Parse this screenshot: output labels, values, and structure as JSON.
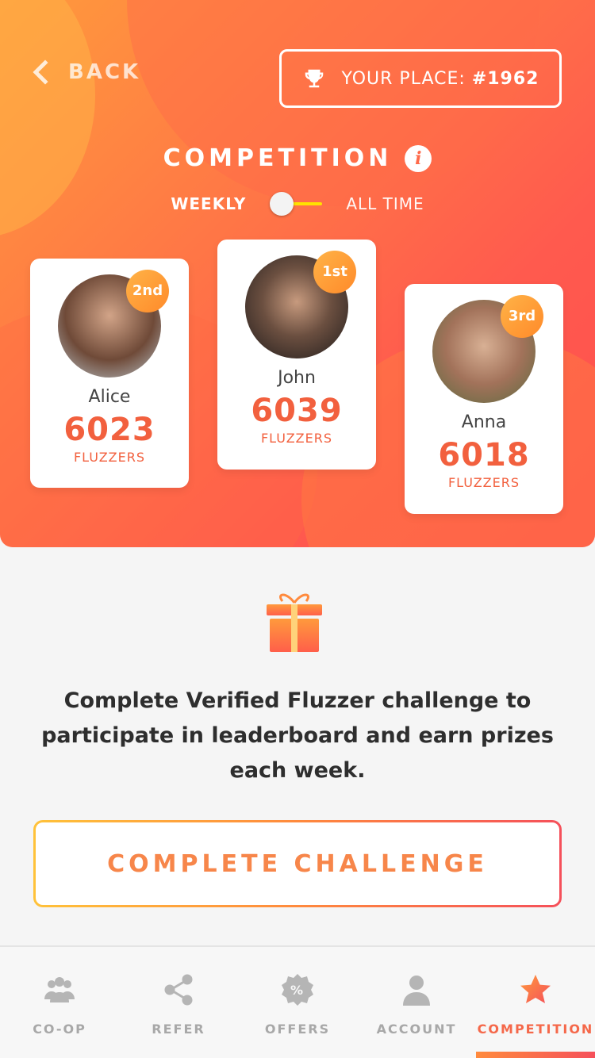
{
  "header": {
    "back_label": "BACK",
    "your_place_label": "YOUR PLACE:",
    "your_place_value": "#1962",
    "title": "COMPETITION",
    "info_icon": "i"
  },
  "period_toggle": {
    "left_label": "WEEKLY",
    "right_label": "ALL TIME",
    "selected": "WEEKLY"
  },
  "leaderboard": [
    {
      "rank": "2nd",
      "name": "Alice",
      "score": "6023",
      "unit": "FLUZZERS"
    },
    {
      "rank": "1st",
      "name": "John",
      "score": "6039",
      "unit": "FLUZZERS"
    },
    {
      "rank": "3rd",
      "name": "Anna",
      "score": "6018",
      "unit": "FLUZZERS"
    }
  ],
  "message": "Complete Verified Fluzzer challenge to participate in leaderboard and earn prizes each week.",
  "cta_label": "COMPLETE CHALLENGE",
  "nav": [
    {
      "label": "CO-OP",
      "icon": "group-icon"
    },
    {
      "label": "REFER",
      "icon": "share-icon"
    },
    {
      "label": "OFFERS",
      "icon": "discount-badge-icon"
    },
    {
      "label": "ACCOUNT",
      "icon": "user-icon"
    },
    {
      "label": "COMPETITION",
      "icon": "star-icon",
      "active": true
    }
  ],
  "colors": {
    "accent": "#f5684a",
    "score": "#f2603e",
    "toggle_track": "#ffe200"
  }
}
